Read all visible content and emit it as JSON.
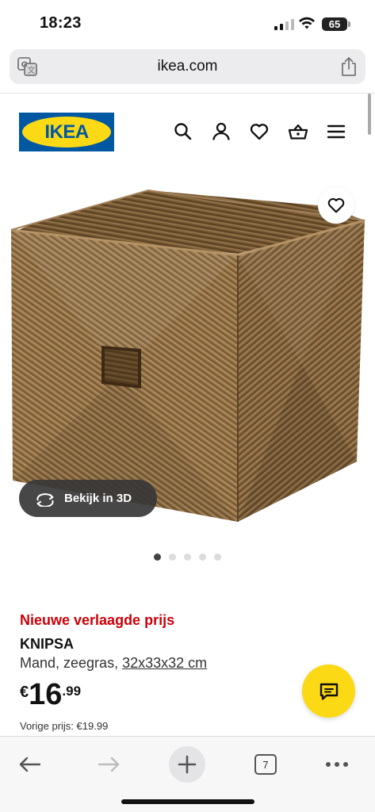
{
  "status_bar": {
    "time": "18:23",
    "battery": "65"
  },
  "browser": {
    "host": "ikea.com",
    "tabs_count": "7"
  },
  "header": {
    "logo_text": "IKEA"
  },
  "view3d": {
    "label": "Bekijk in 3D"
  },
  "carousel": {
    "total": 5,
    "active_index": 0
  },
  "product": {
    "promo": "Nieuwe verlaagde prijs",
    "name": "KNIPSA",
    "description": "Mand, zeegras,",
    "dimensions": "32x33x32 cm",
    "price_currency": "€",
    "price_int": "16",
    "price_dec": ".99",
    "previous_price": "Vorige prijs: €19.99"
  },
  "colors": {
    "ikea_blue": "#0058a3",
    "ikea_yellow": "#fbd914",
    "promo_red": "#cc0008"
  },
  "icons": [
    "translate-icon",
    "share-icon",
    "search-icon",
    "user-icon",
    "heart-icon",
    "basket-icon",
    "menu-icon",
    "rotate-3d-icon",
    "chat-icon",
    "back-icon",
    "forward-icon",
    "plus-icon",
    "tabs-icon",
    "more-icon"
  ]
}
